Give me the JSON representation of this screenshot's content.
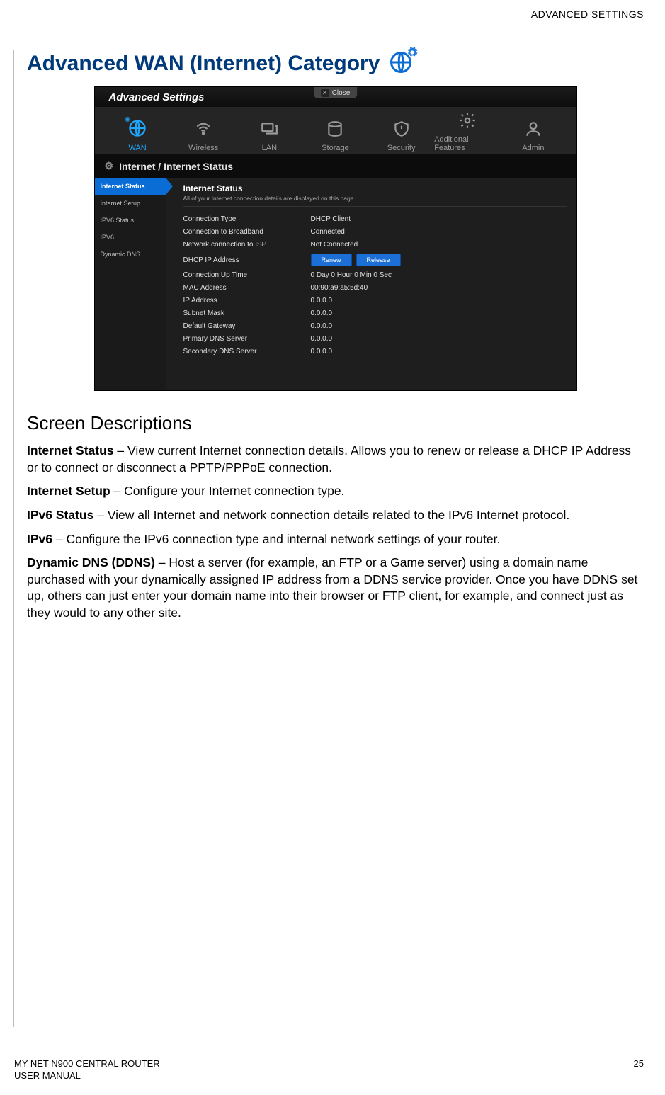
{
  "page_header": "ADVANCED SETTINGS",
  "section_title": "Advanced WAN (Internet) Category",
  "screenshot": {
    "window_title": "Advanced Settings",
    "close_label": "Close",
    "tabs": [
      {
        "label": "WAN",
        "active": true,
        "icon": "globe"
      },
      {
        "label": "Wireless",
        "icon": "wifi"
      },
      {
        "label": "LAN",
        "icon": "monitor"
      },
      {
        "label": "Storage",
        "icon": "hdd"
      },
      {
        "label": "Security",
        "icon": "shield"
      },
      {
        "label": "Additional Features",
        "icon": "gear"
      },
      {
        "label": "Admin",
        "icon": "user"
      }
    ],
    "breadcrumb": "Internet / Internet Status",
    "sidebar": [
      {
        "label": "Internet Status",
        "active": true
      },
      {
        "label": "Internet Setup"
      },
      {
        "label": "IPV6 Status"
      },
      {
        "label": "IPV6"
      },
      {
        "label": "Dynamic DNS"
      }
    ],
    "main_title": "Internet Status",
    "main_subtitle": "All of your Internet connection details are displayed on this page.",
    "buttons": {
      "renew": "Renew",
      "release": "Release"
    },
    "rows": [
      {
        "label": "Connection Type",
        "value": "DHCP Client"
      },
      {
        "label": "Connection to Broadband",
        "value": "Connected"
      },
      {
        "label": "Network connection to ISP",
        "value": "Not Connected"
      },
      {
        "label": "DHCP IP Address",
        "value": "__buttons__"
      },
      {
        "label": "Connection Up Time",
        "value": "0 Day 0 Hour 0 Min 0 Sec"
      },
      {
        "label": "MAC Address",
        "value": "00:90:a9:a5:5d:40"
      },
      {
        "label": "IP Address",
        "value": "0.0.0.0"
      },
      {
        "label": "Subnet Mask",
        "value": "0.0.0.0"
      },
      {
        "label": "Default Gateway",
        "value": "0.0.0.0"
      },
      {
        "label": "Primary DNS Server",
        "value": "0.0.0.0"
      },
      {
        "label": "Secondary DNS Server",
        "value": "0.0.0.0"
      }
    ]
  },
  "doc_heading": "Screen Descriptions",
  "descriptions": [
    {
      "term": "Internet Status",
      "text": " – View current Internet connection details. Allows you to renew or release a DHCP IP Address or to connect or disconnect a PPTP/PPPoE connection."
    },
    {
      "term": "Internet Setup",
      "text": " – Configure your Internet connection type."
    },
    {
      "term": "IPv6 Status",
      "text": " – View all Internet and network connection details related to the IPv6 Internet protocol."
    },
    {
      "term": "IPv6",
      "text": " – Configure the IPv6 connection type and internal network settings of your router."
    },
    {
      "term": "Dynamic DNS (DDNS)",
      "text": " – Host a server (for example, an FTP or a Game server) using a domain name purchased with your dynamically assigned IP address from a DDNS service provider. Once you have DDNS set up, others can just enter your domain name into their browser or FTP client, for example, and connect just as they would to any other site."
    }
  ],
  "footer": {
    "left1": "MY NET N900 CENTRAL ROUTER",
    "left2": "USER MANUAL",
    "right": "25"
  }
}
